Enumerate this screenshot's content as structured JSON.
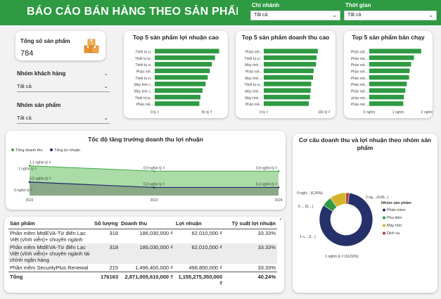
{
  "header": {
    "title": "BÁO CÁO BÁN HÀNG THEO SẢN PHẨM",
    "brand_color": "#2e9a42"
  },
  "filters": {
    "branch": {
      "label": "Chi nhánh",
      "value": "Tất cả"
    },
    "time": {
      "label": "Thời gian",
      "value": "Tất cả"
    }
  },
  "kpi": {
    "label": "Tổng số sản phẩm",
    "value": "784",
    "icon": "boxes-icon"
  },
  "slicers": {
    "customer_group": {
      "label": "Nhóm khách hàng",
      "value": "Tất cả"
    },
    "product_group": {
      "label": "Nhóm sản phẩm",
      "value": "Tất cả"
    }
  },
  "chart_data": [
    {
      "type": "bar",
      "orientation": "horizontal",
      "title": "Top 5 sản phẩm lợi nhuận cao",
      "categories": [
        "Thiết bị vi...",
        "Thiết bị lư...",
        "Thiết bị vi...",
        "Phần mề...",
        "Thiết bị vi...",
        "Máy tính c...",
        "Máy tính c...",
        "Thiết bị lư...",
        "Phần mề..."
      ],
      "values": [
        62,
        58,
        55,
        53,
        51,
        49,
        46,
        44,
        43
      ],
      "xticks": [
        "0 tỷ ₫",
        "50 tỷ ₫"
      ],
      "xlim": [
        0,
        65
      ]
    },
    {
      "type": "bar",
      "orientation": "horizontal",
      "title": "Top 5 sản phẩm doanh thu cao",
      "categories": [
        "Phần mề...",
        "Thiết bị vi...",
        "Máy tính ...",
        "Phần mề...",
        "Máy tính ...",
        "Thiết bị vi...",
        "Máy tính ...",
        "Máy tính ...",
        "Phần mề..."
      ],
      "values": [
        90,
        88,
        87,
        83,
        82,
        79,
        78,
        77,
        75
      ],
      "xticks": [
        "0 tỷ ₫",
        "100 tỷ ₫"
      ],
      "xlim": [
        0,
        110
      ]
    },
    {
      "type": "bar",
      "orientation": "horizontal",
      "title": "Top 5 sản phẩm bán chạy",
      "categories": [
        "Phần mề...",
        "Phần mề...",
        "Phần mề...",
        "Phần mề...",
        "Phần mề...",
        "Phần mề...",
        "Phần mề...",
        "phần mề...",
        "Phần mề..."
      ],
      "values": [
        1800,
        1550,
        1450,
        1400,
        1380,
        1300,
        1250,
        1200,
        1180
      ],
      "xticks": [
        "0 nghìn",
        "1 nghìn",
        "2 nghìn"
      ],
      "xlim": [
        0,
        2000
      ]
    },
    {
      "type": "area",
      "title": "Tốc độ tăng trưởng doanh thu lợi nhuận",
      "legend": [
        "Tổng doanh thu",
        "Tổng lợi nhuận"
      ],
      "x": [
        "2022",
        "2023",
        "2024"
      ],
      "yticks": [
        "1 nghìn tỷ ₫",
        "0 nghìn tỷ ₫"
      ],
      "series": [
        {
          "name": "Tổng doanh thu",
          "values": [
            1.1,
            0.9,
            0.9
          ],
          "labels": [
            "1,1 nghìn tỷ ₫",
            "0,9 nghìn tỷ ₫",
            "0,9 nghìn tỷ ₫"
          ],
          "color": "#8fd08a"
        },
        {
          "name": "Tổng lợi nhuận",
          "values": [
            0.5,
            0.3,
            0.3
          ],
          "labels": [
            "0,5 nghìn tỷ ₫",
            "0,3 nghìn tỷ ₫",
            "0,3 nghìn tỷ ₫"
          ],
          "color": "#1f2a6b"
        }
      ],
      "ylim": [
        0,
        1.4
      ]
    },
    {
      "type": "pie",
      "title": "Cơ cấu doanh thu và lợi nhuận theo nhóm sản phẩm",
      "legend_title": "Nhóm sản phẩm",
      "categories": [
        "Phần mềm",
        "Phụ kiện",
        "Máy tính",
        "Dịch vụ"
      ],
      "colors": [
        "#26306b",
        "#2e9a42",
        "#d4b42a",
        "#b03a3a"
      ],
      "values": [
        82,
        6,
        10,
        2
      ],
      "labels": [
        "1 nghìn tỷ ₫ (16,53%)",
        "0 ... (5,...)",
        "0 nghì... (6,35%)",
        "2 ng... (4,65...)",
        "1 n... (1...)"
      ]
    }
  ],
  "table": {
    "headers": [
      "Sản phẩm",
      "Số lượng",
      "Doanh thu",
      "Lợi nhuận",
      "Tỷ suất lợi nhuận"
    ],
    "rows": [
      [
        "Phần mềm MtdEVA-Từ điển Lạc Việt (vĩnh viễn)+ chuyên ngành",
        "318",
        "186,030,000 ₫",
        "62,010,000 ₫",
        "33.33%"
      ],
      [
        "Phần mềm MtdEVA-Từ điển Lạc Việt (vĩnh viễn)+ chuyên ngành tài chính ngân hàng",
        "318",
        "186,030,000 ₫",
        "62,010,000 ₫",
        "33.33%"
      ],
      [
        "Phần mềm SecurityPlus Renewal",
        "215",
        "1,496,400,000 ₫",
        "498,800,000 ₫",
        "33.33%"
      ]
    ],
    "total": [
      "Tổng",
      "176163",
      "2,871,005,610,000 ₫",
      "1,155,275,350,000 ₫",
      "40.24%"
    ]
  }
}
